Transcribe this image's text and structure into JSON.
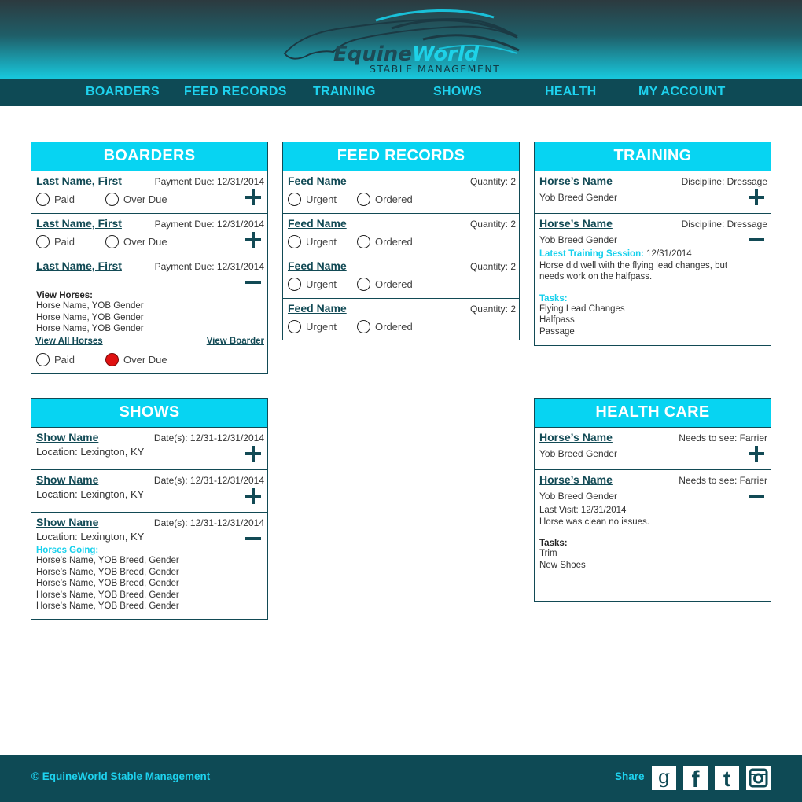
{
  "brand": {
    "name_part1": "Equine",
    "name_part2": "World",
    "subtitle": "STABLE MANAGEMENT"
  },
  "nav": [
    "BOARDERS",
    "FEED RECORDS",
    "TRAINING",
    "SHOWS",
    "HEALTH",
    "MY ACCOUNT"
  ],
  "boarders": {
    "title": "BOARDERS",
    "items": [
      {
        "name": "Last Name, First",
        "meta": "Payment Due: 12/31/2014",
        "paid": "Paid",
        "overdue": "Over Due"
      },
      {
        "name": "Last Name, First",
        "meta": "Payment Due: 12/31/2014",
        "paid": "Paid",
        "overdue": "Over Due"
      },
      {
        "name": "Last Name, First",
        "meta": "Payment Due: 12/31/2014",
        "view_horses_label": "View Horses:",
        "horses": [
          "Horse Name, YOB Gender",
          "Horse Name, YOB Gender",
          "Horse Name, YOB Gender"
        ],
        "view_all": "View All Horses",
        "view_boarder": "View Boarder",
        "paid": "Paid",
        "overdue": "Over Due",
        "overdue_selected": true
      }
    ]
  },
  "feed": {
    "title": "FEED RECORDS",
    "items": [
      {
        "name": "Feed Name",
        "meta": "Quantity: 2",
        "urgent": "Urgent",
        "ordered": "Ordered"
      },
      {
        "name": "Feed Name",
        "meta": "Quantity: 2",
        "urgent": "Urgent",
        "ordered": "Ordered"
      },
      {
        "name": "Feed Name",
        "meta": "Quantity: 2",
        "urgent": "Urgent",
        "ordered": "Ordered"
      },
      {
        "name": "Feed Name",
        "meta": "Quantity: 2",
        "urgent": "Urgent",
        "ordered": "Ordered"
      }
    ]
  },
  "training": {
    "title": "TRAINING",
    "items": [
      {
        "name": "Horse’s Name",
        "meta": "Discipline: Dressage",
        "detail": "Yob Breed Gender"
      },
      {
        "name": "Horse’s Name",
        "meta": "Discipline: Dressage",
        "detail": "Yob Breed Gender",
        "session_label": "Latest Training Session:",
        "session_date": "12/31/2014",
        "notes": [
          "Horse did well with the flying lead changes, but",
          "needs work on the halfpass."
        ],
        "tasks_label": "Tasks:",
        "tasks": [
          "Flying Lead Changes",
          "Halfpass",
          "Passage"
        ]
      }
    ]
  },
  "shows": {
    "title": "SHOWS",
    "items": [
      {
        "name": "Show Name",
        "meta": "Date(s): 12/31-12/31/2014",
        "location": "Location: Lexington, KY"
      },
      {
        "name": "Show Name",
        "meta": "Date(s): 12/31-12/31/2014",
        "location": "Location: Lexington, KY"
      },
      {
        "name": "Show Name",
        "meta": "Date(s): 12/31-12/31/2014",
        "location": "Location: Lexington, KY",
        "horses_label": "Horses Going:",
        "horses": [
          "Horse’s Name, YOB Breed, Gender",
          "Horse’s Name, YOB Breed, Gender",
          "Horse’s Name, YOB Breed, Gender",
          "Horse’s Name, YOB Breed, Gender",
          "Horse’s Name, YOB Breed, Gender"
        ]
      }
    ]
  },
  "health": {
    "title": "HEALTH CARE",
    "items": [
      {
        "name": "Horse’s Name",
        "meta": "Needs to see: Farrier",
        "detail": "Yob Breed Gender"
      },
      {
        "name": "Horse’s Name",
        "meta": "Needs to see: Farrier",
        "detail": "Yob Breed Gender",
        "last_visit": "Last Visit: 12/31/2014",
        "visit_note": "Horse was clean no issues.",
        "tasks_label": "Tasks:",
        "tasks": [
          "Trim",
          "New Shoes"
        ]
      }
    ]
  },
  "footer": {
    "copyright": "© EquineWorld Stable Management",
    "share_label": "Share",
    "social": [
      {
        "icon": "google-icon",
        "glyph": "g"
      },
      {
        "icon": "facebook-icon",
        "glyph": "f"
      },
      {
        "icon": "twitter-icon",
        "glyph": "t"
      },
      {
        "icon": "instagram-icon",
        "glyph": ""
      }
    ]
  },
  "colors": {
    "accent": "#07d4f2",
    "dark": "#0e4a55",
    "alert": "#e01111"
  }
}
